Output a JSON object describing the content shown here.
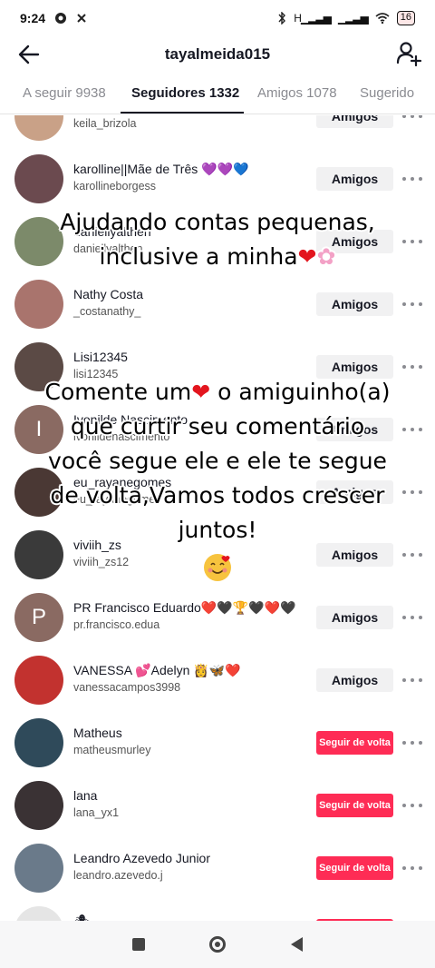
{
  "status": {
    "time": "9:24",
    "network": "H",
    "battery": "16"
  },
  "header": {
    "title": "tayalmeida015"
  },
  "tabs": [
    {
      "label": "A seguir 9938"
    },
    {
      "label": "Seguidores 1332"
    },
    {
      "label": "Amigos 1078"
    },
    {
      "label": "Sugerido"
    }
  ],
  "colors": {
    "accent": "#fe2c55",
    "friends_btn": "#f1f1f2",
    "text": "#161823"
  },
  "followers": [
    {
      "name": "",
      "handle": "keila_brizola",
      "button": "Amigos",
      "avatar_letter": ""
    },
    {
      "name": "karolline||Mãe de Três 💜💜💙",
      "handle": "karollineborgess",
      "button": "Amigos",
      "avatar_letter": ""
    },
    {
      "name": "daniellyalthen",
      "handle": "daniellyalthen",
      "button": "Amigos",
      "avatar_letter": ""
    },
    {
      "name": "Nathy Costa",
      "handle": "_costanathy_",
      "button": "Amigos",
      "avatar_letter": ""
    },
    {
      "name": "Lisi12345",
      "handle": "lisi12345",
      "button": "Amigos",
      "avatar_letter": ""
    },
    {
      "name": "Ivonilde Nascimento",
      "handle": "ivonildenascimento",
      "button": "Amigos",
      "avatar_letter": "I"
    },
    {
      "name": "eu_rayanegomes",
      "handle": "eu_rayanegomes",
      "button": "Amigos",
      "avatar_letter": ""
    },
    {
      "name": "viviih_zs",
      "handle": "viviih_zs12",
      "button": "Amigos",
      "avatar_letter": ""
    },
    {
      "name": "PR Francisco Eduardo❤️🖤🏆🖤❤️🖤",
      "handle": "pr.francisco.edua",
      "button": "Amigos",
      "avatar_letter": "P"
    },
    {
      "name": "VANESSA 💕Adelyn 👸🦋❤️",
      "handle": "vanessacampos3998",
      "button": "Amigos",
      "avatar_letter": ""
    },
    {
      "name": "Matheus",
      "handle": "matheusmurley",
      "button": "Seguir de volta",
      "avatar_letter": ""
    },
    {
      "name": "lana",
      "handle": "lana_yx1",
      "button": "Seguir de volta",
      "avatar_letter": ""
    },
    {
      "name": "Leandro Azevedo Junior",
      "handle": "leandro.azevedo.j",
      "button": "Seguir de volta",
      "avatar_letter": ""
    },
    {
      "name": "🕷",
      "handle": "",
      "button": "Seguir de volta",
      "avatar_letter": ""
    }
  ],
  "overlay": {
    "line1": "Ajudando contas pequenas,",
    "line2": "inclusive a minha",
    "line3a": "Comente um",
    "line3b": " o amiguinho(a)",
    "line4": "que curtir seu comentário",
    "line5": "você segue ele e ele te segue",
    "line6": "de volta,Vamos todos crescer",
    "line7": "juntos!"
  },
  "icons": [
    "back-arrow-icon",
    "add-user-icon",
    "more-options-icon",
    "heart-emoji-icon",
    "flower-emoji-icon",
    "smiling-face-hearts-icon"
  ]
}
